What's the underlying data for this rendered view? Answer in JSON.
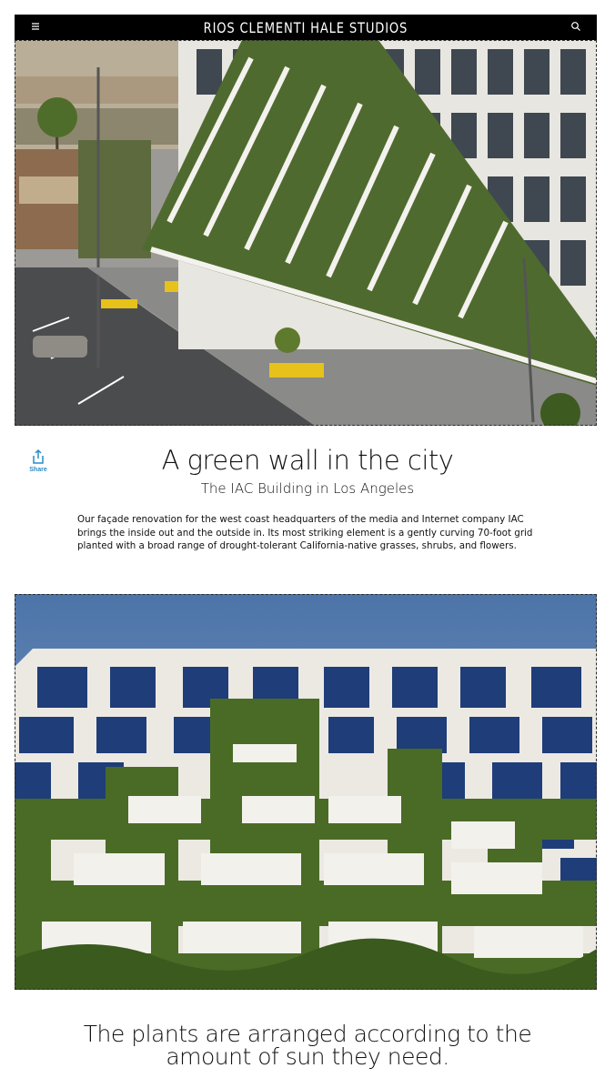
{
  "header": {
    "brand": "RIOS CLEMENTI HALE STUDIOS",
    "menu_icon": "hamburger-menu-icon",
    "search_icon": "search-icon"
  },
  "hero_image": {
    "subject": "IAC building green wall aerial view"
  },
  "share": {
    "label": "Share",
    "icon": "share-icon",
    "color": "#2a8bc9"
  },
  "article": {
    "title": "A green wall in the city",
    "subtitle": "The IAC Building in Los Angeles",
    "body": "Our façade renovation for the west coast headquarters of the media and Internet company IAC brings the inside out and the outside in. Its most striking element is a gently curving 70-foot grid planted with a broad range of drought-tolerant California-native grasses, shrubs, and flowers."
  },
  "second_image": {
    "subject": "Green wall facade close-up"
  },
  "caption": "The plants are arranged according to the amount of sun they need."
}
